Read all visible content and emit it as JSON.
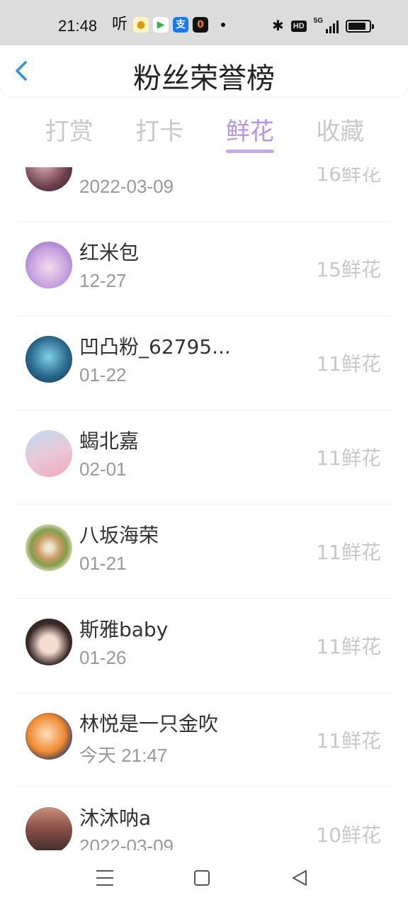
{
  "status_bar": {
    "time": "21:48",
    "listen_glyph": "听",
    "apps": [
      "app-icon-1",
      "app-icon-2",
      "alipay-icon",
      "app-icon-4"
    ],
    "alipay_glyph": "支",
    "app4_glyph": "0",
    "hd": "HD",
    "network": "5G"
  },
  "header": {
    "title": "粉丝荣誉榜"
  },
  "tabs": [
    {
      "label": "打赏",
      "active": false
    },
    {
      "label": "打卡",
      "active": false
    },
    {
      "label": "鲜花",
      "active": true
    },
    {
      "label": "收藏",
      "active": false
    }
  ],
  "fans": [
    {
      "name": "",
      "date": "2022-03-09",
      "count": "16鲜花"
    },
    {
      "name": "红米包",
      "date": "12-27",
      "count": "15鲜花"
    },
    {
      "name": "凹凸粉_62795...",
      "date": "01-22",
      "count": "11鲜花"
    },
    {
      "name": "蝎北嘉",
      "date": "02-01",
      "count": "11鲜花"
    },
    {
      "name": "八坂海荣",
      "date": "01-21",
      "count": "11鲜花"
    },
    {
      "name": "斯雅baby",
      "date": "01-26",
      "count": "11鲜花"
    },
    {
      "name": "林悦是一只金吹",
      "date": "今天 21:47",
      "count": "11鲜花"
    },
    {
      "name": "沐沐呐a",
      "date": "2022-03-09",
      "count": "10鲜花"
    }
  ],
  "colors": {
    "accent": "#b794e6",
    "back_arrow": "#2f8fe0",
    "inactive_tab": "#c8c8c8"
  }
}
